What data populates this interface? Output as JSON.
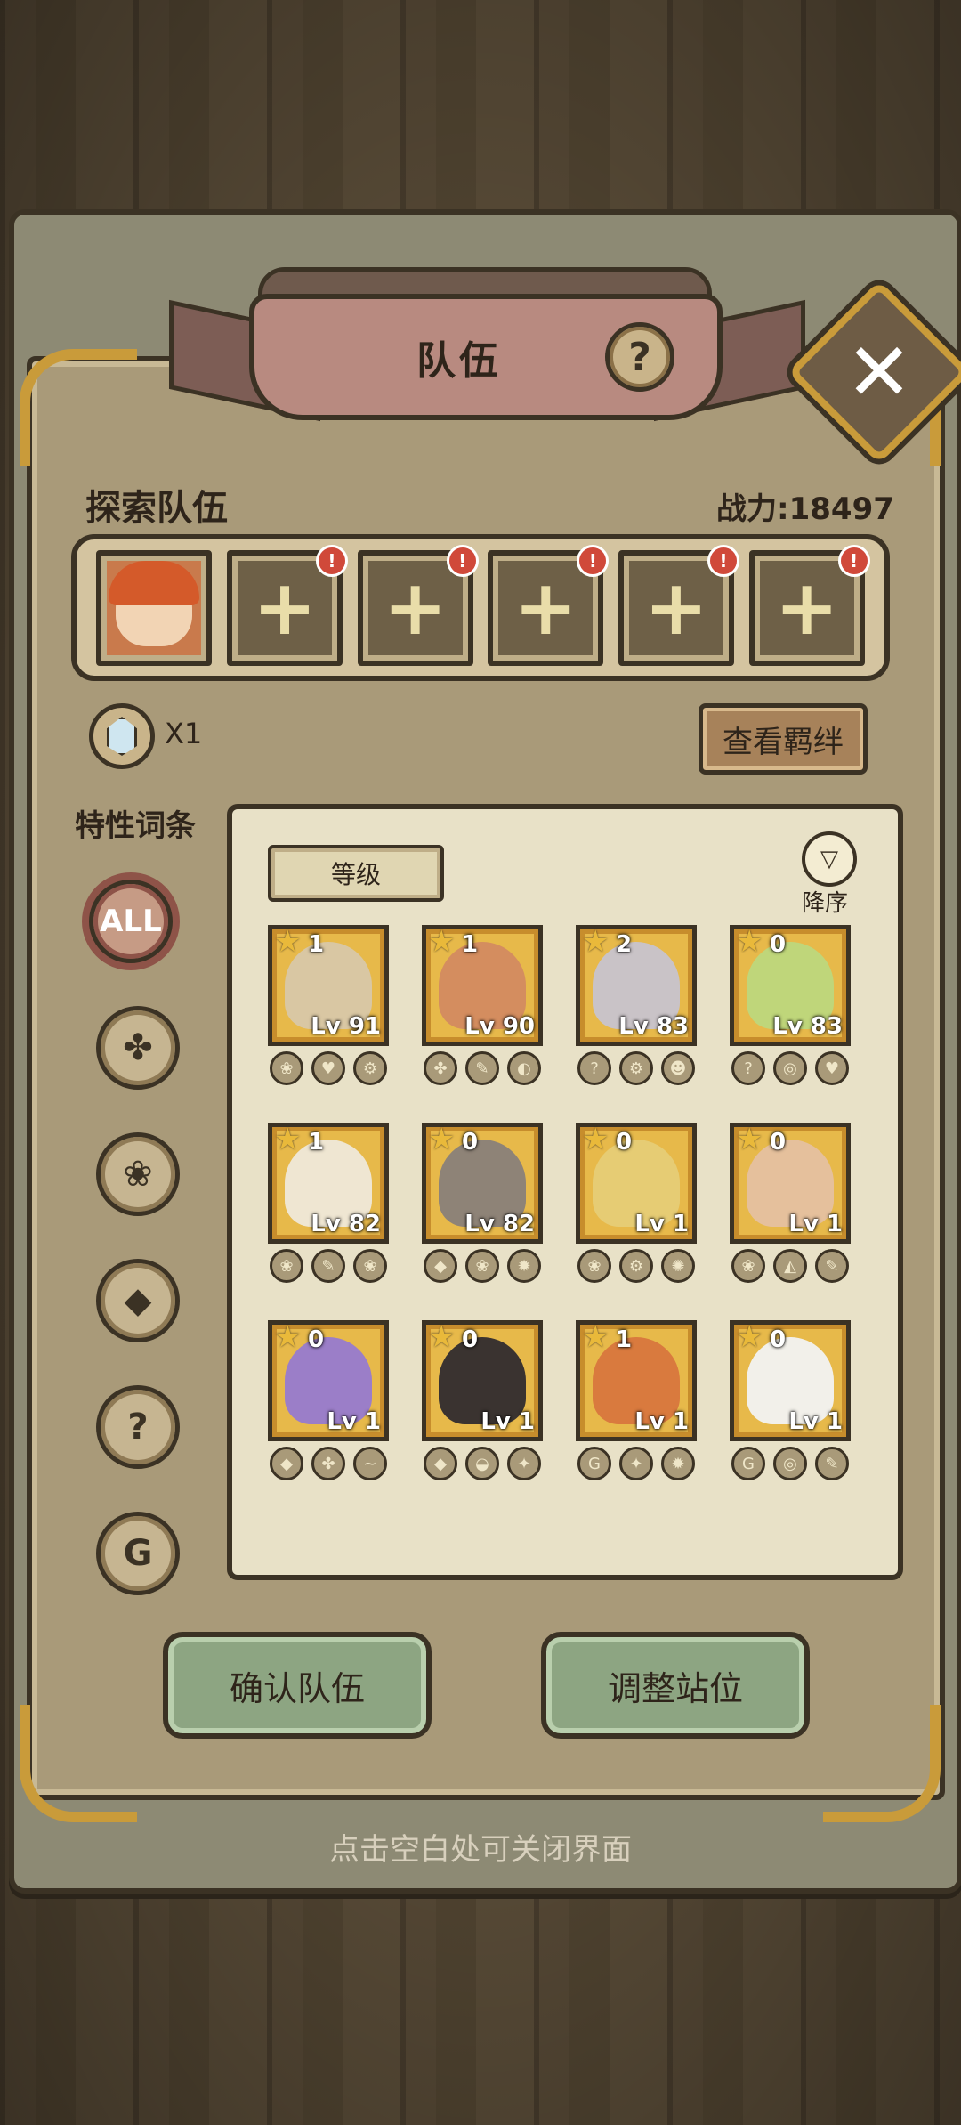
{
  "header": {
    "title": "队伍",
    "help_glyph": "?",
    "close_glyph": "✕"
  },
  "team": {
    "title": "探索队伍",
    "power": "战力:18497",
    "slots": [
      {
        "type": "hero"
      },
      {
        "type": "empty",
        "glyph": "+",
        "alert": "!"
      },
      {
        "type": "empty",
        "glyph": "+",
        "alert": "!"
      },
      {
        "type": "empty",
        "glyph": "+",
        "alert": "!"
      },
      {
        "type": "empty",
        "glyph": "+",
        "alert": "!"
      },
      {
        "type": "empty",
        "glyph": "+",
        "alert": "!"
      }
    ]
  },
  "crystal": {
    "count": "X1"
  },
  "bond_button": "查看羁绊",
  "traits": {
    "title": "特性词条",
    "items": [
      {
        "label": "ALL",
        "icon": "all-icon"
      },
      {
        "label": "✤",
        "icon": "leaf-icon"
      },
      {
        "label": "❀",
        "icon": "paw-icon"
      },
      {
        "label": "◆",
        "icon": "crystal-icon"
      },
      {
        "label": "?",
        "icon": "question-icon"
      },
      {
        "label": "G",
        "icon": "hook-icon"
      }
    ]
  },
  "sort": {
    "field": "等级",
    "order": "降序",
    "arrow": "▽"
  },
  "heroes": [
    {
      "stars": "1",
      "level": "Lv 91",
      "color": "#d9c7a3",
      "traits": [
        "❀",
        "♥",
        "⚙"
      ]
    },
    {
      "stars": "1",
      "level": "Lv 90",
      "color": "#d48d5f",
      "traits": [
        "✤",
        "✎",
        "◐"
      ]
    },
    {
      "stars": "2",
      "level": "Lv 83",
      "color": "#c9c3c7",
      "traits": [
        "?",
        "⚙",
        "☻"
      ]
    },
    {
      "stars": "0",
      "level": "Lv 83",
      "color": "#bfd67a",
      "traits": [
        "?",
        "◎",
        "♥"
      ]
    },
    {
      "stars": "1",
      "level": "Lv 82",
      "color": "#efe6d2",
      "traits": [
        "❀",
        "✎",
        "❀"
      ]
    },
    {
      "stars": "0",
      "level": "Lv 82",
      "color": "#8e8377",
      "traits": [
        "◆",
        "❀",
        "✹"
      ]
    },
    {
      "stars": "0",
      "level": "Lv 1",
      "color": "#e6cc74",
      "traits": [
        "❀",
        "⚙",
        "✺"
      ]
    },
    {
      "stars": "0",
      "level": "Lv 1",
      "color": "#e5c09c",
      "traits": [
        "❀",
        "◭",
        "✎"
      ]
    },
    {
      "stars": "0",
      "level": "Lv 1",
      "color": "#9b7ec8",
      "traits": [
        "◆",
        "✤",
        "~"
      ]
    },
    {
      "stars": "0",
      "level": "Lv 1",
      "color": "#3a3330",
      "traits": [
        "◆",
        "◒",
        "✦"
      ]
    },
    {
      "stars": "1",
      "level": "Lv 1",
      "color": "#d97a3e",
      "traits": [
        "G",
        "✦",
        "✹"
      ]
    },
    {
      "stars": "0",
      "level": "Lv 1",
      "color": "#f2f0ea",
      "traits": [
        "G",
        "◎",
        "✎"
      ]
    }
  ],
  "buttons": {
    "confirm": "确认队伍",
    "adjust": "调整站位"
  },
  "close_hint": "点击空白处可关闭界面"
}
